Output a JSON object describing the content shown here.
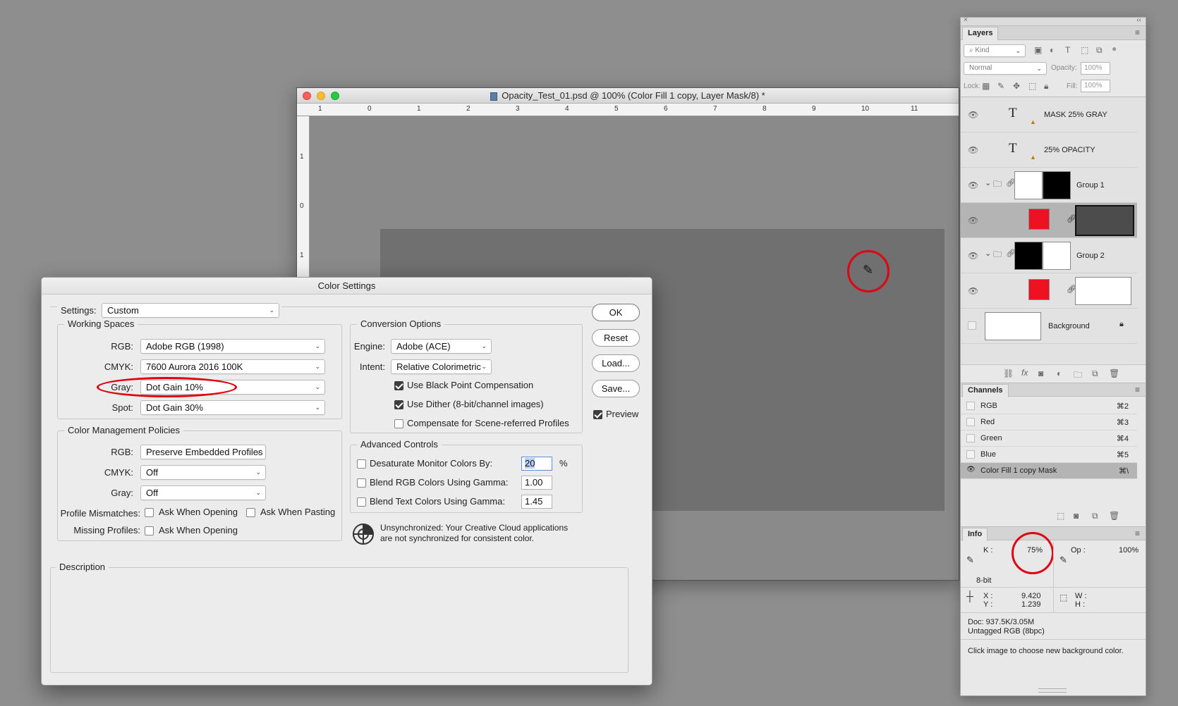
{
  "document": {
    "title": "Opacity_Test_01.psd @ 100% (Color Fill 1 copy, Layer Mask/8) *",
    "ruler_top_labels": [
      "1",
      "0",
      "1",
      "2",
      "3",
      "4",
      "5",
      "6",
      "7",
      "8",
      "9",
      "10",
      "11"
    ],
    "ruler_left_labels": [
      "1",
      "0",
      "1"
    ]
  },
  "dialog": {
    "title": "Color Settings",
    "settings_label": "Settings:",
    "settings_value": "Custom",
    "working_spaces": {
      "title": "Working Spaces",
      "rgb_label": "RGB:",
      "rgb_value": "Adobe RGB (1998)",
      "cmyk_label": "CMYK:",
      "cmyk_value": "7600 Aurora 2016 100K",
      "gray_label": "Gray:",
      "gray_value": "Dot Gain 10%",
      "spot_label": "Spot:",
      "spot_value": "Dot Gain 30%"
    },
    "policies": {
      "title": "Color Management Policies",
      "rgb_label": "RGB:",
      "rgb_value": "Preserve Embedded Profiles",
      "cmyk_label": "CMYK:",
      "cmyk_value": "Off",
      "gray_label": "Gray:",
      "gray_value": "Off",
      "mismatch_label": "Profile Mismatches:",
      "ask_opening": "Ask When Opening",
      "ask_pasting": "Ask When Pasting",
      "missing_label": "Missing Profiles:",
      "missing_ask_opening": "Ask When Opening"
    },
    "conversion": {
      "title": "Conversion Options",
      "engine_label": "Engine:",
      "engine_value": "Adobe (ACE)",
      "intent_label": "Intent:",
      "intent_value": "Relative Colorimetric",
      "black_point": "Use Black Point Compensation",
      "dither": "Use Dither (8-bit/channel images)",
      "scene": "Compensate for Scene-referred Profiles"
    },
    "advanced": {
      "title": "Advanced Controls",
      "desaturate": "Desaturate Monitor Colors By:",
      "desaturate_value": "20",
      "percent": "%",
      "blend_rgb": "Blend RGB Colors Using Gamma:",
      "blend_rgb_value": "1.00",
      "blend_text": "Blend Text Colors Using Gamma:",
      "blend_text_value": "1.45"
    },
    "unsync": "Unsynchronized: Your Creative Cloud applications are not synchronized for consistent color.",
    "description_title": "Description",
    "buttons": {
      "ok": "OK",
      "reset": "Reset",
      "load": "Load...",
      "save": "Save..."
    },
    "preview": "Preview"
  },
  "layers": {
    "tab": "Layers",
    "kind": "Kind",
    "blend_mode": "Normal",
    "opacity_label": "Opacity:",
    "opacity_value": "100%",
    "lock_label": "Lock:",
    "fill_label": "Fill:",
    "fill_value": "100%",
    "rows": [
      "MASK 25% GRAY",
      "25% OPACITY",
      "Group 1",
      "Group 2",
      "Background"
    ]
  },
  "channels": {
    "tab": "Channels",
    "rows": [
      {
        "name": "RGB",
        "shortcut": "⌘2"
      },
      {
        "name": "Red",
        "shortcut": "⌘3"
      },
      {
        "name": "Green",
        "shortcut": "⌘4"
      },
      {
        "name": "Blue",
        "shortcut": "⌘5"
      },
      {
        "name": "Color Fill 1 copy Mask",
        "shortcut": "⌘\\"
      }
    ]
  },
  "info": {
    "tab": "Info",
    "k_label": "K :",
    "k_value": "75%",
    "op_label": "Op :",
    "op_value": "100%",
    "bit_depth": "8-bit",
    "x_label": "X :",
    "x_value": "9.420",
    "y_label": "Y :",
    "y_value": "1.239",
    "w_label": "W :",
    "h_label": "H :",
    "doc": "Doc: 937.5K/3.05M",
    "profile": "Untagged RGB (8bpc)",
    "hint": "Click image to choose new background color."
  },
  "colors": {
    "accent_red": "#e00010",
    "swatch_red": "#ee1122"
  }
}
